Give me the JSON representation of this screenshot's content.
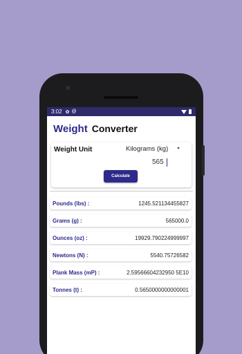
{
  "statusbar": {
    "time": "3:02"
  },
  "app": {
    "title_first": "Weight",
    "title_second": "Converter"
  },
  "input": {
    "unit_label": "Weight Unit",
    "selected_unit": "Kilograms (kg)",
    "value": "565",
    "calculate_label": "Calculate"
  },
  "results": [
    {
      "label": "Pounds (lbs) :",
      "value": "1245.521134455827"
    },
    {
      "label": "Grams (g) :",
      "value": "565000.0"
    },
    {
      "label": "Ounces (oz) :",
      "value": "19929.790224999997"
    },
    {
      "label": "Newtons (N) :",
      "value": "5540.75726582"
    },
    {
      "label": "Plank Mass (mP) :",
      "value": "2.59566604232950 5E10"
    },
    {
      "label": "Tonnes (t) :",
      "value": "0.5650000000000001"
    }
  ],
  "colors": {
    "background": "#a59ccb",
    "accent": "#2e2a8c",
    "statusbar": "#2e2a6b"
  }
}
